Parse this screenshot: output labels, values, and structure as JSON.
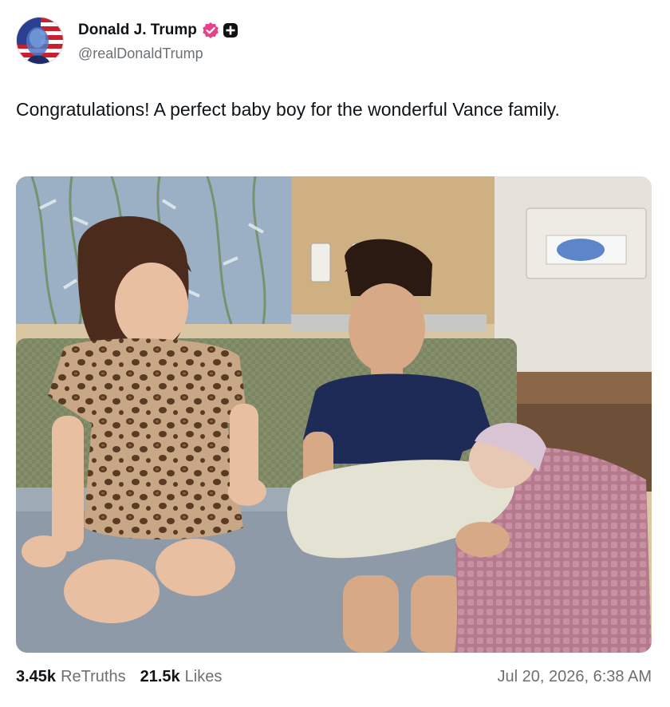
{
  "author": {
    "display_name": "Donald J. Trump",
    "handle": "@realDonaldTrump",
    "avatar_icon": "flag-portrait-avatar",
    "verified_badge_icon": "verified-badge-icon",
    "verified_badge_color": "#e8418b",
    "plus_badge_icon": "plus-badge-icon",
    "plus_badge_color": "#111111"
  },
  "post": {
    "text": "Congratulations! A perfect baby boy for the wonderful Vance family.",
    "image_subject": "photo-two-children-with-newborn"
  },
  "stats": {
    "retruths_count": "3.45k",
    "retruths_label": "ReTruths",
    "likes_count": "21.5k",
    "likes_label": "Likes"
  },
  "timestamp": "Jul 20, 2026, 6:38 AM"
}
